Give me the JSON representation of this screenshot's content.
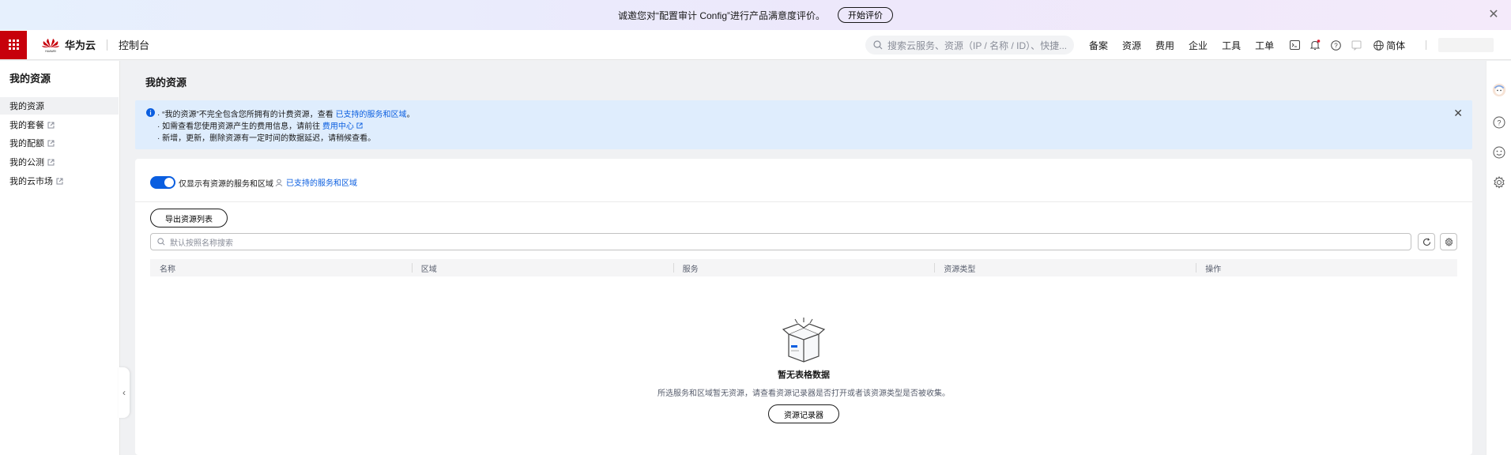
{
  "banner": {
    "text": "诚邀您对“配置审计 Config”进行产品满意度评价。",
    "button_label": "开始评价",
    "close_icon": "close-icon"
  },
  "header": {
    "logo_text": "华为云",
    "logo_subtext": "HUAWEI",
    "console_label": "控制台",
    "search_placeholder": "搜索云服务、资源（IP / 名称 / ID）、快捷...",
    "nav": [
      "备案",
      "资源",
      "费用",
      "企业",
      "工具",
      "工单"
    ],
    "language": "简体"
  },
  "sidebar": {
    "title": "我的资源",
    "items": [
      {
        "label": "我的资源",
        "external": false
      },
      {
        "label": "我的套餐",
        "external": true
      },
      {
        "label": "我的配额",
        "external": true
      },
      {
        "label": "我的公测",
        "external": true
      },
      {
        "label": "我的云市场",
        "external": true
      }
    ]
  },
  "main": {
    "page_title": "我的资源",
    "notice": {
      "line1_prefix": "“我的资源”不完全包含您所拥有的计费资源，查看",
      "line1_link": "已支持的服务和区域",
      "line1_suffix": "。",
      "line2_prefix": "如需查看您使用资源产生的费用信息，请前往",
      "line2_link": "费用中心",
      "line3": "新增，更新，删除资源有一定时间的数据延迟，请稍候查看。"
    },
    "toggle_label": "仅显示有资源的服务和区域",
    "toggle_on": true,
    "support_link": "已支持的服务和区域",
    "export_button": "导出资源列表",
    "table_search_placeholder": "默认按照名称搜索",
    "columns": [
      "名称",
      "区域",
      "服务",
      "资源类型",
      "操作"
    ],
    "empty": {
      "title": "暂无表格数据",
      "description": "所选服务和区域暂无资源，请查看资源记录器是否打开或者该资源类型是否被收集。",
      "button": "资源记录器"
    }
  },
  "colors": {
    "brand_red": "#c7000b",
    "link_blue": "#0a5ee0",
    "notice_bg": "#dfedfd"
  }
}
